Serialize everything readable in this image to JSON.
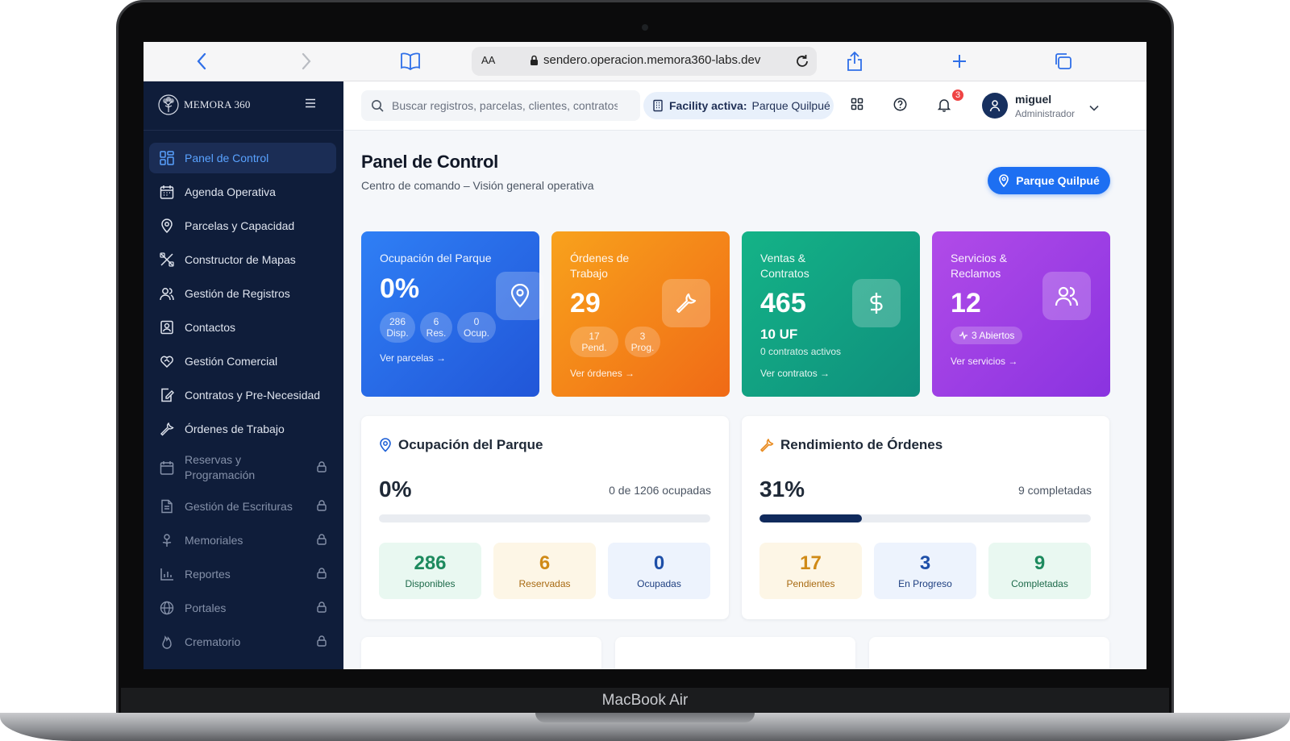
{
  "device": {
    "label": "MacBook Air"
  },
  "browser": {
    "aa_label": "AA",
    "url": "sendero.operacion.memora360-labs.dev"
  },
  "sidebar": {
    "brand": "MEMORA 360",
    "items": [
      {
        "label": "Panel de Control",
        "icon": "dashboard-icon",
        "active": true,
        "locked": false
      },
      {
        "label": "Agenda Operativa",
        "icon": "calendar-icon",
        "active": false,
        "locked": false
      },
      {
        "label": "Parcelas y Capacidad",
        "icon": "map-pin-icon",
        "active": false,
        "locked": false
      },
      {
        "label": "Constructor de Mapas",
        "icon": "tools-icon",
        "active": false,
        "locked": false
      },
      {
        "label": "Gestión de Registros",
        "icon": "users-icon",
        "active": false,
        "locked": false
      },
      {
        "label": "Contactos",
        "icon": "contact-card-icon",
        "active": false,
        "locked": false
      },
      {
        "label": "Gestión Comercial",
        "icon": "handshake-heart-icon",
        "active": false,
        "locked": false
      },
      {
        "label": "Contratos y Pre-Necesidad",
        "icon": "document-edit-icon",
        "active": false,
        "locked": false
      },
      {
        "label": "Órdenes de Trabajo",
        "icon": "wrench-icon",
        "active": false,
        "locked": false
      },
      {
        "label": "Reservas y Programación",
        "icon": "calendar-icon",
        "active": false,
        "locked": true
      },
      {
        "label": "Gestión de Escrituras",
        "icon": "document-icon",
        "active": false,
        "locked": true
      },
      {
        "label": "Memoriales",
        "icon": "flower-icon",
        "active": false,
        "locked": true
      },
      {
        "label": "Reportes",
        "icon": "bar-chart-icon",
        "active": false,
        "locked": true
      },
      {
        "label": "Portales",
        "icon": "globe-icon",
        "active": false,
        "locked": true
      },
      {
        "label": "Crematorio",
        "icon": "flame-icon",
        "active": false,
        "locked": true
      }
    ]
  },
  "topbar": {
    "search_placeholder": "Buscar registros, parcelas, clientes, contratos...",
    "facility_label": "Facility activa:",
    "facility_value": "Parque Quilpué",
    "notifications_count": "3",
    "user_name": "miguel",
    "user_role": "Administrador"
  },
  "page": {
    "title": "Panel de Control",
    "subtitle": "Centro de comando – Visión general operativa",
    "park_button": "Parque Quilpué"
  },
  "cards": {
    "occupancy": {
      "title": "Ocupación del Parque",
      "value": "0%",
      "chips": [
        {
          "num": "286",
          "label": "Disp."
        },
        {
          "num": "6",
          "label": "Res."
        },
        {
          "num": "0",
          "label": "Ocup."
        }
      ],
      "link": "Ver parcelas →"
    },
    "orders": {
      "title": "Órdenes de Trabajo",
      "value": "29",
      "chips": [
        {
          "num": "17",
          "label": "Pend."
        },
        {
          "num": "3",
          "label": "Prog."
        }
      ],
      "link": "Ver órdenes →"
    },
    "sales": {
      "title": "Ventas & Contratos",
      "value": "465",
      "uf": "10 UF",
      "uf_sub": "0 contratos activos",
      "link": "Ver contratos →"
    },
    "services": {
      "title": "Servicios & Reclamos",
      "value": "12",
      "open_pill": "3 Abiertos",
      "link": "Ver servicios →"
    }
  },
  "panels": {
    "occupancy": {
      "title": "Ocupación del Parque",
      "value": "0%",
      "note": "0 de 1206 ocupadas",
      "progress": 0,
      "stats": [
        {
          "value": "286",
          "label": "Disponibles"
        },
        {
          "value": "6",
          "label": "Reservadas"
        },
        {
          "value": "0",
          "label": "Ocupadas"
        }
      ]
    },
    "orders": {
      "title": "Rendimiento de Órdenes",
      "value": "31%",
      "note": "9 completadas",
      "progress": 0.31,
      "stats": [
        {
          "value": "17",
          "label": "Pendientes"
        },
        {
          "value": "3",
          "label": "En Progreso"
        },
        {
          "value": "9",
          "label": "Completadas"
        }
      ]
    }
  }
}
